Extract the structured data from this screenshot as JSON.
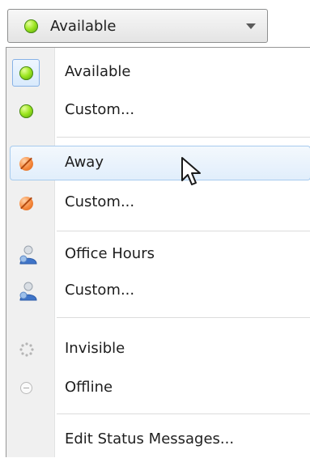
{
  "status_selector": {
    "current_label": "Available",
    "current_icon": "green-dot-icon"
  },
  "menu": {
    "items": [
      {
        "label": "Available",
        "icon": "available-icon"
      },
      {
        "label": "Custom...",
        "icon": "available-icon"
      },
      {
        "label": "Away",
        "icon": "away-icon"
      },
      {
        "label": "Custom...",
        "icon": "away-icon"
      },
      {
        "label": "Office Hours",
        "icon": "office-hours-icon"
      },
      {
        "label": "Custom...",
        "icon": "office-hours-icon"
      },
      {
        "label": "Invisible",
        "icon": "invisible-icon"
      },
      {
        "label": "Offline",
        "icon": "offline-icon"
      },
      {
        "label": "Edit Status Messages...",
        "icon": ""
      }
    ]
  },
  "colors": {
    "available": "#7ed321",
    "away": "#f08a3c",
    "hover_border": "#a7cbee"
  }
}
